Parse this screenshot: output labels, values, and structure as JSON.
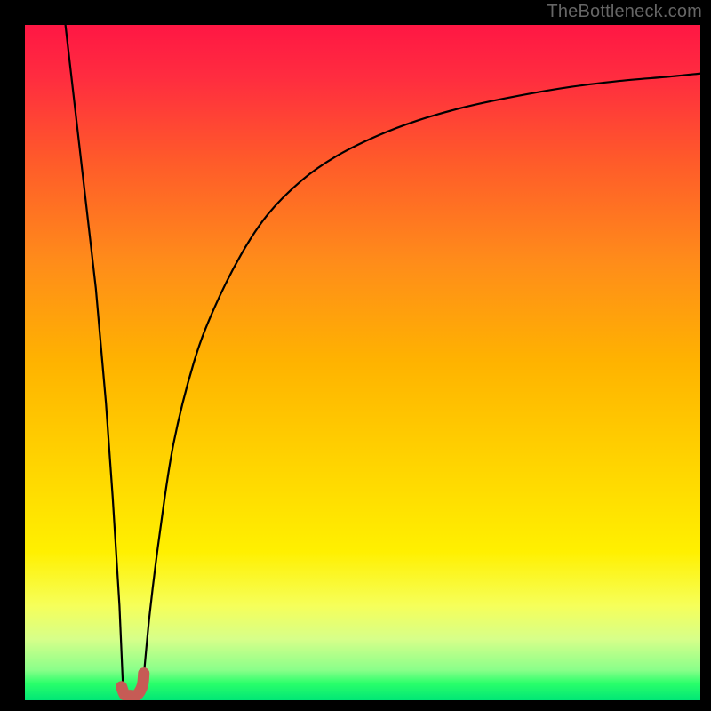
{
  "watermark": "TheBottleneck.com",
  "gradient": {
    "stops": [
      {
        "offset": 0.0,
        "color": "#ff1744"
      },
      {
        "offset": 0.08,
        "color": "#ff2d3f"
      },
      {
        "offset": 0.2,
        "color": "#ff5a2a"
      },
      {
        "offset": 0.35,
        "color": "#ff8c1a"
      },
      {
        "offset": 0.5,
        "color": "#ffb300"
      },
      {
        "offset": 0.65,
        "color": "#ffd400"
      },
      {
        "offset": 0.78,
        "color": "#fff000"
      },
      {
        "offset": 0.86,
        "color": "#f6ff5a"
      },
      {
        "offset": 0.91,
        "color": "#d6ff8a"
      },
      {
        "offset": 0.955,
        "color": "#8aff8a"
      },
      {
        "offset": 0.975,
        "color": "#2aff6a"
      },
      {
        "offset": 1.0,
        "color": "#00e676"
      }
    ]
  },
  "chart_data": {
    "type": "line",
    "title": "",
    "xlabel": "",
    "ylabel": "",
    "xlim": [
      0,
      100
    ],
    "ylim": [
      0,
      100
    ],
    "x_valley_range": [
      14.5,
      17.5
    ],
    "series": [
      {
        "name": "left-branch",
        "x": [
          6.0,
          7.5,
          9.0,
          10.5,
          12.0,
          13.0,
          14.0,
          14.5
        ],
        "y": [
          100,
          87,
          74,
          61,
          44,
          30,
          14,
          2.5
        ]
      },
      {
        "name": "right-branch",
        "x": [
          17.5,
          18.5,
          20.0,
          22.0,
          25.0,
          28.0,
          32.0,
          36.0,
          41.0,
          46.0,
          52.0,
          58.0,
          65.0,
          72.0,
          80.0,
          88.0,
          95.0,
          100.0
        ],
        "y": [
          2.5,
          13,
          25,
          38,
          50,
          58,
          66,
          72,
          77,
          80.5,
          83.5,
          85.8,
          87.8,
          89.3,
          90.7,
          91.7,
          92.3,
          92.8
        ]
      }
    ],
    "marker": {
      "name": "valley-marker",
      "color": "#c65b55",
      "points": [
        {
          "x": 14.3,
          "y": 2.0
        },
        {
          "x": 14.8,
          "y": 0.8
        },
        {
          "x": 15.6,
          "y": 0.7
        },
        {
          "x": 16.6,
          "y": 0.8
        },
        {
          "x": 17.4,
          "y": 2.2
        },
        {
          "x": 17.6,
          "y": 4.0
        }
      ]
    }
  }
}
